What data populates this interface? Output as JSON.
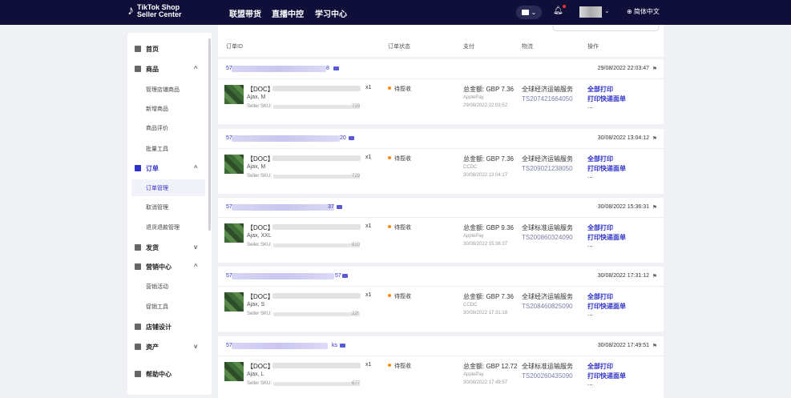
{
  "header": {
    "logo_glyph": "♪",
    "logo_line1": "TikTok Shop",
    "logo_line2": "Seller Center",
    "nav": [
      "联盟带货",
      "直播中控",
      "学习中心"
    ],
    "lang": "⊕ 简体中文"
  },
  "sidebar": {
    "items": [
      {
        "label": "首页",
        "type": "main",
        "icon": "home-icon"
      },
      {
        "label": "商品",
        "type": "main",
        "icon": "product-icon",
        "expand": "^"
      },
      {
        "label": "管理店铺商品",
        "type": "sub"
      },
      {
        "label": "新增商品",
        "type": "sub"
      },
      {
        "label": "商品评价",
        "type": "sub"
      },
      {
        "label": "批量工具",
        "type": "sub"
      },
      {
        "label": "订单",
        "type": "main",
        "icon": "order-icon",
        "expand": "^",
        "active": true
      },
      {
        "label": "订单管理",
        "type": "sub",
        "active": true
      },
      {
        "label": "取消管理",
        "type": "sub"
      },
      {
        "label": "退货退款管理",
        "type": "sub"
      },
      {
        "label": "发货",
        "type": "main",
        "icon": "shipping-icon",
        "expand": "v"
      },
      {
        "label": "营销中心",
        "type": "main",
        "icon": "marketing-icon",
        "expand": "^"
      },
      {
        "label": "营销活动",
        "type": "sub"
      },
      {
        "label": "促销工具",
        "type": "sub"
      },
      {
        "label": "店铺设计",
        "type": "main",
        "icon": "shop-design-icon"
      },
      {
        "label": "资产",
        "type": "main",
        "icon": "assets-icon",
        "expand": "v"
      },
      {
        "label": "帮助中心",
        "type": "main",
        "icon": "help-icon"
      }
    ]
  },
  "table": {
    "columns": [
      "订单ID",
      "订单状态",
      "支付",
      "物流",
      "操作"
    ]
  },
  "orders": [
    {
      "id_prefix": "57",
      "id_suffix": "8",
      "date": "29/08/2022 22:03:47",
      "title": "【DOC】",
      "qty": "x1",
      "variant": "Ajax, M",
      "sku_label": "Seller SKU:",
      "sku_end": "729",
      "status": "待揽收",
      "total": "总金额:   GBP 7.36",
      "method": "ApplePay",
      "paid_at": "29/08/2022 22:03:52",
      "carrier": "全球经济运输服务",
      "tracking": "TS207421664050",
      "act1": "全部打印",
      "act2": "打印快递面单",
      "act3": "..."
    },
    {
      "id_prefix": "57",
      "id_suffix": "20",
      "date": "30/08/2022 13:04:12",
      "title": "【DOC】",
      "qty": "x1",
      "variant": "Ajax, M",
      "sku_label": "Seller SKU:",
      "sku_end": "729",
      "status": "待揽收",
      "total": "总金额:   GBP 7.36",
      "method": "CCDC",
      "paid_at": "30/08/2022 13:04:17",
      "carrier": "全球经济运输服务",
      "tracking": "TS209021238050",
      "act1": "全部打印",
      "act2": "打印快递面单",
      "act3": "..."
    },
    {
      "id_prefix": "57",
      "id_suffix": "37",
      "date": "30/08/2022 15:36:31",
      "title": "【DOC】",
      "qty": "x1",
      "variant": "Ajax, XXL",
      "sku_label": "Seller SKU:",
      "sku_end": "810",
      "status": "待揽收",
      "total": "总金额:   GBP 9.36",
      "method": "ApplePay",
      "paid_at": "30/08/2022 15:36:37",
      "carrier": "全球标准运输服务",
      "tracking": "TS200860324090",
      "act1": "全部打印",
      "act2": "打印快递面单",
      "act3": "..."
    },
    {
      "id_prefix": "57",
      "id_suffix": "57",
      "date": "30/08/2022 17:31:12",
      "title": "【DOC】",
      "qty": "x1",
      "variant": "Ajax, S",
      "sku_label": "Seller SKU:",
      "sku_end": "22f",
      "status": "待揽收",
      "total": "总金额:   GBP 7.36",
      "method": "CCDC",
      "paid_at": "30/08/2022 17:31:18",
      "carrier": "全球经济运输服务",
      "tracking": "TS208460825090",
      "act1": "全部打印",
      "act2": "打印快递面单",
      "act3": "..."
    },
    {
      "id_prefix": "57",
      "id_suffix": "ks",
      "date": "30/08/2022 17:49:51",
      "title": "【DOC】",
      "qty": "x1",
      "variant": "Ajax, L",
      "sku_label": "Seller SKU:",
      "sku_end": "677",
      "status": "待揽收",
      "total": "总金额:   GBP 12.72",
      "method": "ApplePay",
      "paid_at": "30/08/2022 17:49:57",
      "carrier": "全球标准运输服务",
      "tracking": "TS200260435090",
      "act1": "全部打印",
      "act2": "打印快递面单",
      "act3": "..."
    }
  ]
}
